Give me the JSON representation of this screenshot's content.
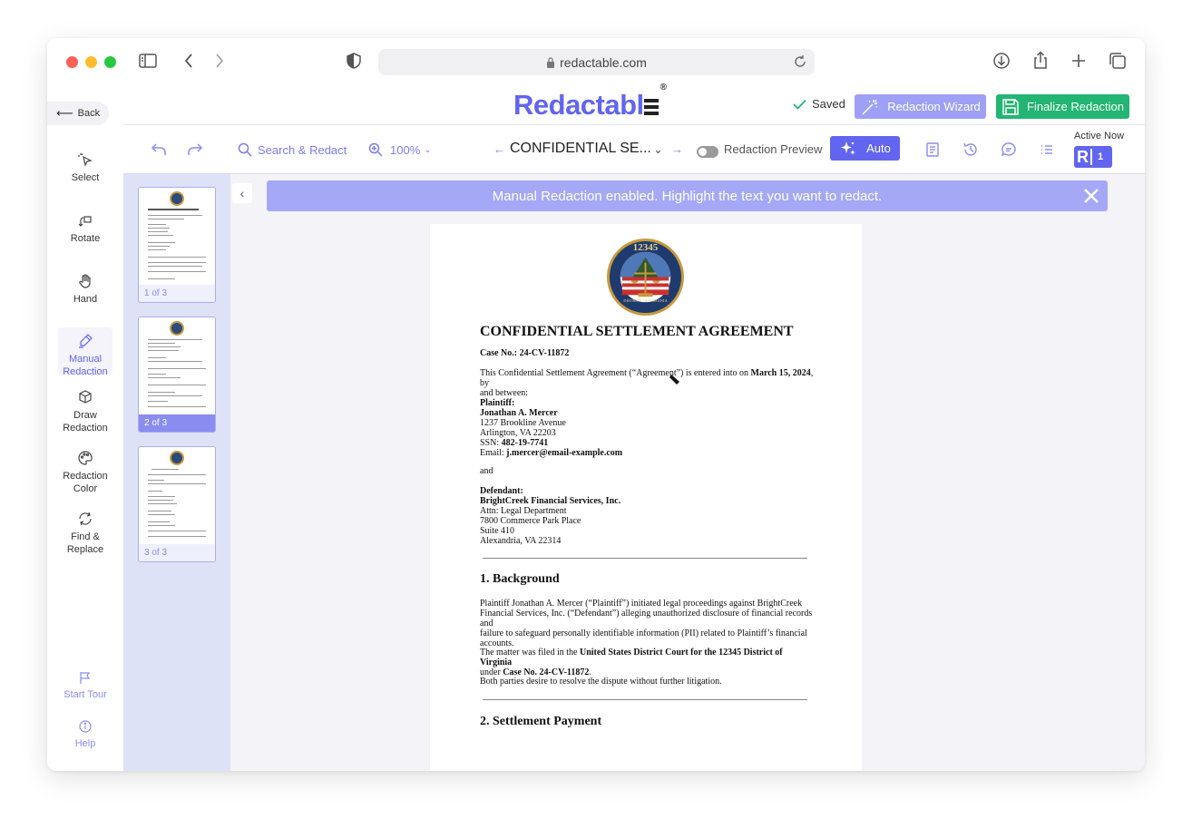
{
  "browser": {
    "url": "redactable.com"
  },
  "header": {
    "logo": "Redactabl",
    "logo_mark": "®",
    "saved_label": "Saved",
    "wizard_label": "Redaction Wizard",
    "finalize_label": "Finalize Redaction",
    "back_label": "Back"
  },
  "toolbar": {
    "search_label": "Search & Redact",
    "zoom_label": "100%",
    "doc_title": "CONFIDENTIAL SE...",
    "preview_label": "Redaction Preview",
    "auto_label": "Auto",
    "active_now_label": "Active Now",
    "active_initial": "R",
    "active_count": "1"
  },
  "sidebar": {
    "items": [
      {
        "label": "Select"
      },
      {
        "label": "Rotate"
      },
      {
        "label": "Hand"
      },
      {
        "label": "Manual Redaction"
      },
      {
        "label": "Draw Redaction"
      },
      {
        "label": "Redaction Color"
      },
      {
        "label": "Find & Replace"
      },
      {
        "label": "Start Tour"
      },
      {
        "label": "Help"
      }
    ]
  },
  "thumbnails": [
    {
      "label": "1 of 3"
    },
    {
      "label": "2 of 3"
    },
    {
      "label": "3 of 3"
    }
  ],
  "banner": {
    "message": "Manual Redaction enabled. Highlight the text you want to redact."
  },
  "document": {
    "seal_text": "12345",
    "seal_bottom": "DISTRICT OF VIRGINIA",
    "title": "CONFIDENTIAL SETTLEMENT AGREEMENT",
    "case_label": "Case No.: 24-CV-11872",
    "intro_1": "This Confidential Settlement Agreement (“Agreement”) is entered into on ",
    "intro_date": "March 15, 2024",
    "intro_2": ", by",
    "intro_3": "and between:",
    "plaintiff_heading": "Plaintiff:",
    "plaintiff_name": "Jonathan A. Mercer",
    "plaintiff_addr1": "1237 Brookline Avenue",
    "plaintiff_addr2": "Arlington, VA 22203",
    "ssn_label": "SSN: ",
    "ssn_value": "482-19-7741",
    "email_label": "Email: ",
    "email_value": "j.mercer@email-example.com",
    "and": "and",
    "defendant_heading": "Defendant:",
    "defendant_name": "BrightCreek Financial Services, Inc.",
    "defendant_addr1": "Attn: Legal Department",
    "defendant_addr2": "7800 Commerce Park Place",
    "defendant_addr3": "Suite 410",
    "defendant_addr4": "Alexandria, VA 22314",
    "section1": "1. Background",
    "bg_p1_l1": "Plaintiff Jonathan A. Mercer (“Plaintiff”) initiated legal proceedings against BrightCreek",
    "bg_p1_l2": "Financial Services, Inc. (“Defendant”) alleging unauthorized disclosure of financial records and",
    "bg_p1_l3": "failure to safeguard personally identifiable information (PII) related to Plaintiff’s financial",
    "bg_p1_l4": "accounts.",
    "bg_p2_a": "The matter was filed in the ",
    "bg_p2_court": "United States District Court for the 12345 District of Virginia",
    "bg_p2_b": "under ",
    "bg_p2_case": "Case No. 24-CV-11872",
    "bg_p2_c": ".",
    "bg_p3": "Both parties desire to resolve the dispute without further litigation.",
    "section2": "2. Settlement Payment"
  },
  "colors": {
    "brand": "#6265ef",
    "finalize": "#22b573",
    "wizard": "#9ea0f5",
    "banner": "#a5a8f6"
  }
}
